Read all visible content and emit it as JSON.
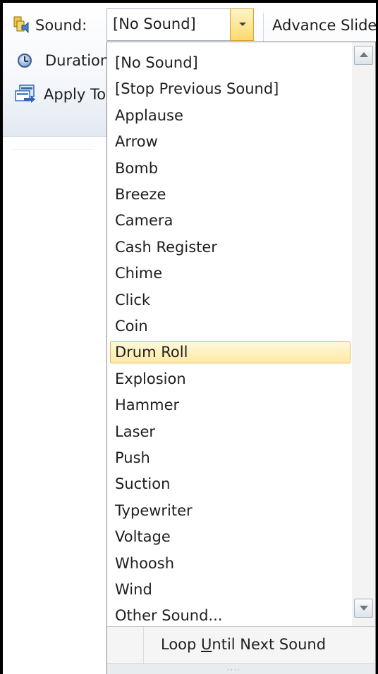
{
  "ribbon": {
    "sound_label": "Sound:",
    "sound_value": "[No Sound]",
    "advance_label": "Advance Slide",
    "duration_label": "Duration",
    "apply_label": "Apply To"
  },
  "icons": {
    "sound": "sound-icon",
    "duration": "clock-icon",
    "apply": "apply-to-all-icon",
    "combo_arrow": "chevron-down-icon",
    "scroll_up": "scroll-up-icon",
    "scroll_down": "scroll-down-icon"
  },
  "dropdown": {
    "items": [
      "[No Sound]",
      "[Stop Previous Sound]",
      "Applause",
      "Arrow",
      "Bomb",
      "Breeze",
      "Camera",
      "Cash Register",
      "Chime",
      "Click",
      "Coin",
      "Drum Roll",
      "Explosion",
      "Hammer",
      "Laser",
      "Push",
      "Suction",
      "Typewriter",
      "Voltage",
      "Whoosh",
      "Wind",
      "Other Sound..."
    ],
    "highlighted": "Drum Roll",
    "loop_label": {
      "before": "Loop ",
      "mnemonic": "U",
      "after": "ntil Next Sound"
    },
    "grip": "····"
  },
  "colors": {
    "highlight_fill": "#ffe9a6",
    "highlight_border": "#e6b84b",
    "combo_arrow_fill": "#ffd970"
  }
}
